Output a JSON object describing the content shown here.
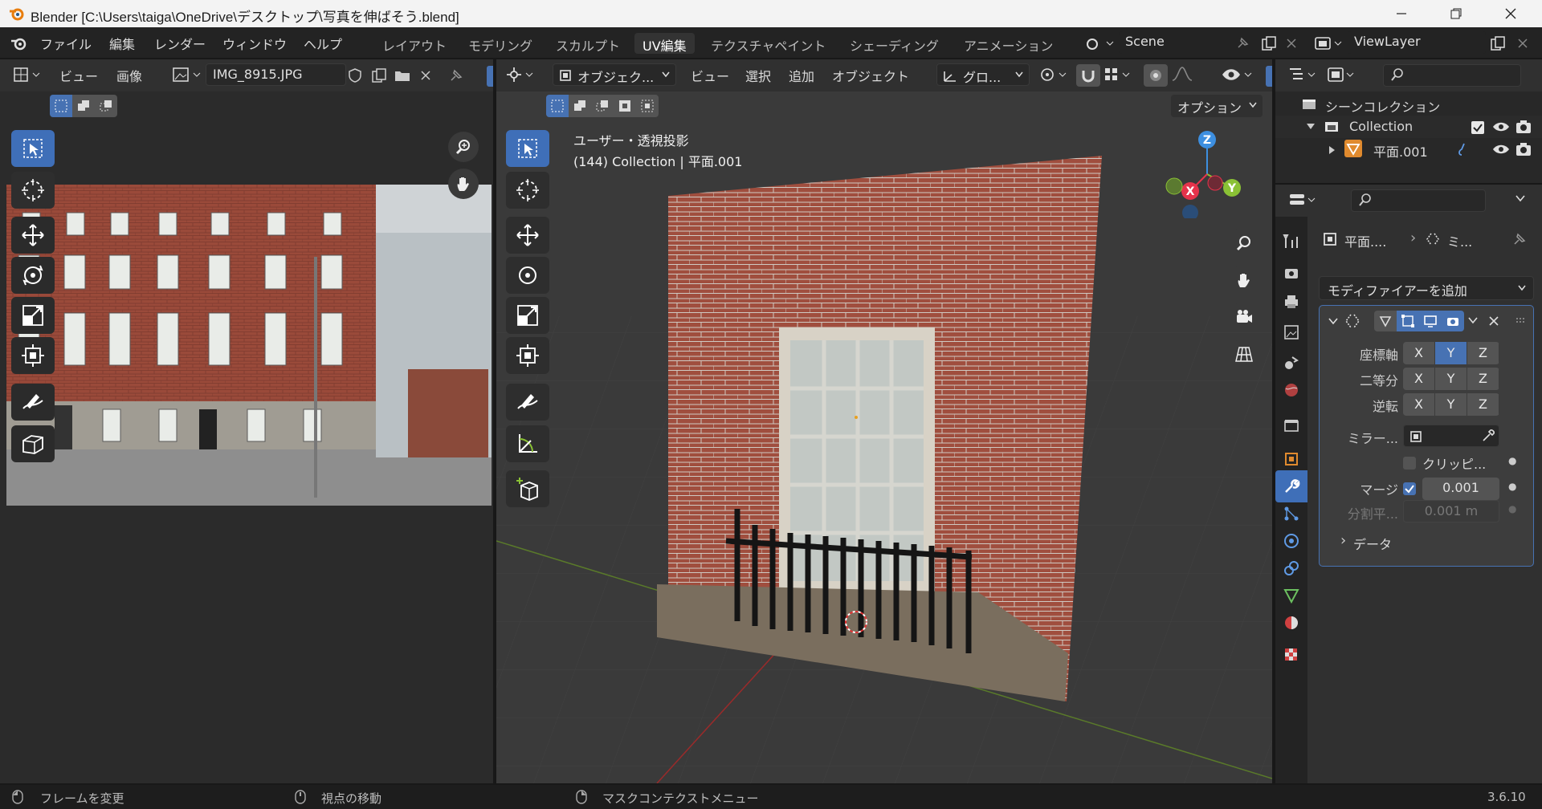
{
  "window": {
    "title": "Blender [C:\\Users\\taiga\\OneDrive\\デスクトップ\\写真を伸ばそう.blend]"
  },
  "menu": {
    "items": [
      "ファイル",
      "編集",
      "レンダー",
      "ウィンドウ",
      "ヘルプ"
    ]
  },
  "workspaces": [
    "レイアウト",
    "モデリング",
    "スカルプト",
    "UV編集",
    "テクスチャペイント",
    "シェーディング",
    "アニメーション"
  ],
  "scene": {
    "name": "Scene"
  },
  "view_layer": {
    "name": "ViewLayer"
  },
  "image_editor": {
    "menus": [
      "ビュー",
      "画像"
    ],
    "image_name": "IMG_8915.JPG"
  },
  "viewport": {
    "mode": "オブジェク...",
    "menus": [
      "ビュー",
      "選択",
      "追加",
      "オブジェクト"
    ],
    "transform": "グロ...",
    "options": "オプション",
    "overlay_title": "ユーザー・透視投影",
    "overlay_info": "(144) Collection | 平面.001",
    "axes": {
      "x": "X",
      "y": "Y",
      "z": "Z"
    }
  },
  "outliner": {
    "scene_collection": "シーンコレクション",
    "collection": "Collection",
    "object": "平面.001"
  },
  "properties": {
    "breadcrumb_object": "平面....",
    "breadcrumb_modifier": "ミ...",
    "add_modifier": "モディファイアーを追加",
    "labels": {
      "axis": "座標軸",
      "bisect": "二等分",
      "flip": "逆転",
      "mirror_obj": "ミラー...",
      "clipping": "クリッピ...",
      "merge": "マージ",
      "bisect_dist": "分割平...",
      "data": "データ"
    },
    "xyz": [
      "X",
      "Y",
      "Z"
    ],
    "merge_value": "0.001",
    "bisect_value": "0.001 m"
  },
  "status": {
    "left": "フレームを変更",
    "mid": "視点の移動",
    "right": "マスクコンテクストメニュー",
    "version": "3.6.10"
  },
  "colors": {
    "accent": "#4772b3",
    "axis_x": "#e5334b",
    "axis_y": "#8ac135",
    "axis_z": "#3d8fe0"
  }
}
